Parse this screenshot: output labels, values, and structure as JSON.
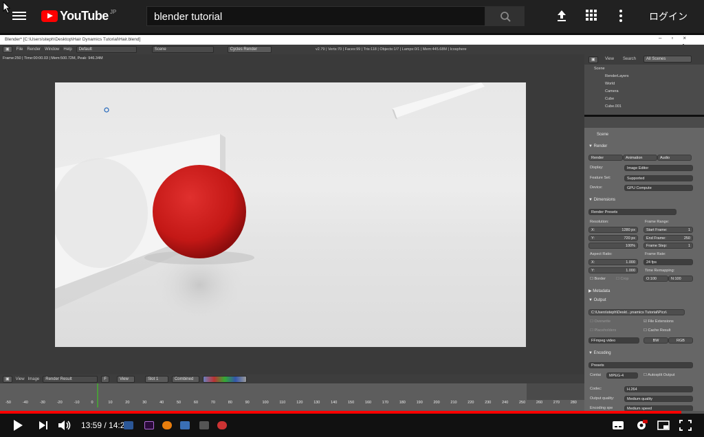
{
  "yt": {
    "logo_text": "YouTube",
    "logo_region": "JP",
    "search_value": "blender tutorial",
    "login_label": "ログイン"
  },
  "blender": {
    "title": "Blender* [C:\\Users\\steph\\Desktop\\Hair Dynamics Tutorial\\Hair.blend]",
    "menu": [
      "File",
      "Render",
      "Window",
      "Help"
    ],
    "layout": "Default",
    "scene": "Scene",
    "engine": "Cycles Render",
    "stats": "v2.79 | Verts:70 | Faces:99 | Tris:118 | Objects:1/7 | Lamps:0/1 | Mem:445.68M | Icosphere",
    "frame_info": "Frame:250 | Time:00:00.03 | Mem:500.72M, Peak: 946.34M"
  },
  "image_editor": {
    "view": "View",
    "image": "Image",
    "result": "Render Result",
    "f": "F",
    "view2": "View",
    "slot": "Slot 1",
    "combined": "Combined"
  },
  "timeline": {
    "ticks": [
      "-50",
      "-40",
      "-30",
      "-20",
      "-10",
      "0",
      "10",
      "20",
      "30",
      "40",
      "50",
      "60",
      "70",
      "80",
      "90",
      "100",
      "110",
      "120",
      "130",
      "140",
      "150",
      "160",
      "170",
      "180",
      "190",
      "200",
      "210",
      "220",
      "230",
      "240",
      "250",
      "260",
      "270",
      "280"
    ]
  },
  "outliner": {
    "view": "View",
    "search": "Search",
    "filter": "All Scenes",
    "rows": [
      "Scene",
      "RenderLayers",
      "World",
      "Camera",
      "Cube",
      "Cube.001"
    ]
  },
  "props": {
    "scene": "Scene",
    "render_section": "Render",
    "btn_render": "Render",
    "btn_animation": "Animation",
    "btn_audio": "Audio",
    "display_label": "Display:",
    "display_value": "Image Editor",
    "featureset_label": "Feature Set:",
    "featureset_value": "Supported",
    "device_label": "Device:",
    "device_value": "GPU Compute",
    "dimensions_section": "Dimensions",
    "render_presets": "Render Presets",
    "resolution_label": "Resolution:",
    "res_x": "X:",
    "res_x_val": "1280 px",
    "res_y": "Y:",
    "res_y_val": "720 px",
    "res_pct": "100%",
    "frame_range_label": "Frame Range:",
    "start_frame": "Start Frame:",
    "start_val": "1",
    "end_frame": "End Frame:",
    "end_val": "250",
    "frame_step": "Frame Step:",
    "step_val": "1",
    "aspect_label": "Aspect Ratio:",
    "asp_x": "X:",
    "asp_x_val": "1.000",
    "asp_y": "Y:",
    "asp_y_val": "1.000",
    "frame_rate_label": "Frame Rate:",
    "frame_rate_val": "24 fps",
    "time_remap_label": "Time Remapping:",
    "remap_o": "O:100",
    "remap_n": "N:100",
    "border": "Border",
    "crop": "Crop",
    "metadata_section": "Metadata",
    "output_section": "Output",
    "output_path": "C:\\Users\\steph\\Deskt...ynamics Tutorial\\Pics\\",
    "overwrite": "Overwrite",
    "file_ext": "File Extensions",
    "placeholders": "Placeholders",
    "cache_result": "Cache Result",
    "ffmpeg": "FFmpeg video",
    "bw": "BW",
    "rgb": "RGB",
    "encoding_section": "Encoding",
    "presets": "Presets",
    "container_label": "Contai",
    "container_val": "MPEG-4",
    "autosplit": "Autosplit Output",
    "codec_label": "Codec:",
    "codec_val": "H.264",
    "quality_label": "Output quality:",
    "quality_val": "Medium quality",
    "speed_label": "Encoding spe",
    "speed_val": "Medium speed"
  },
  "player": {
    "time": "13:59 / 14:27",
    "progress": 0.968
  }
}
